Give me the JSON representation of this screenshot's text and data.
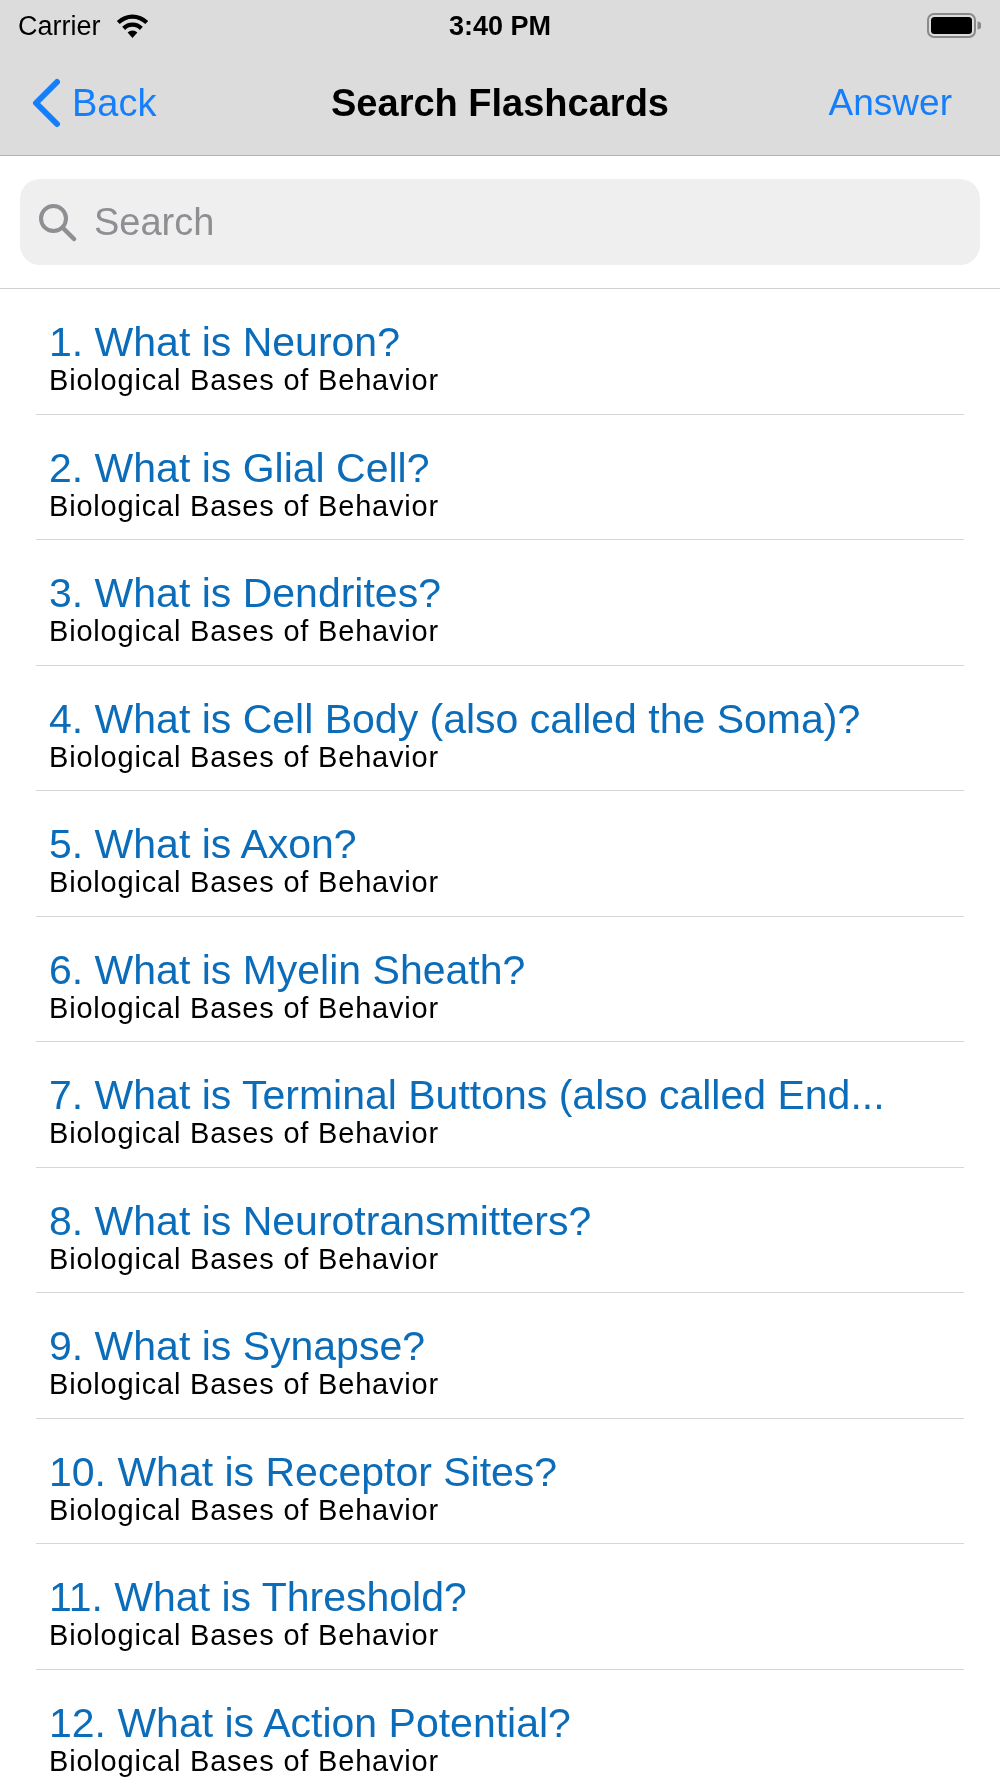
{
  "status_bar": {
    "carrier": "Carrier",
    "time": "3:40 PM"
  },
  "nav_bar": {
    "back": "Back",
    "title": "Search Flashcards",
    "action": "Answer"
  },
  "search": {
    "placeholder": "Search"
  },
  "flashcards": [
    {
      "title": "1. What is Neuron?",
      "category": "Biological Bases of Behavior"
    },
    {
      "title": "2. What is Glial Cell?",
      "category": "Biological Bases of Behavior"
    },
    {
      "title": "3. What is Dendrites?",
      "category": "Biological Bases of Behavior"
    },
    {
      "title": "4. What is Cell Body (also called the Soma)?",
      "category": "Biological Bases of Behavior"
    },
    {
      "title": "5. What is Axon?",
      "category": "Biological Bases of Behavior"
    },
    {
      "title": "6. What is Myelin Sheath?",
      "category": "Biological Bases of Behavior"
    },
    {
      "title": "7. What is Terminal Buttons (also called End...",
      "category": "Biological Bases of Behavior"
    },
    {
      "title": "8. What is Neurotransmitters?",
      "category": "Biological Bases of Behavior"
    },
    {
      "title": "9. What is Synapse?",
      "category": "Biological Bases of Behavior"
    },
    {
      "title": "10. What is Receptor Sites?",
      "category": "Biological Bases of Behavior"
    },
    {
      "title": "11. What is Threshold?",
      "category": "Biological Bases of Behavior"
    },
    {
      "title": "12. What is Action Potential?",
      "category": "Biological Bases of Behavior"
    }
  ]
}
